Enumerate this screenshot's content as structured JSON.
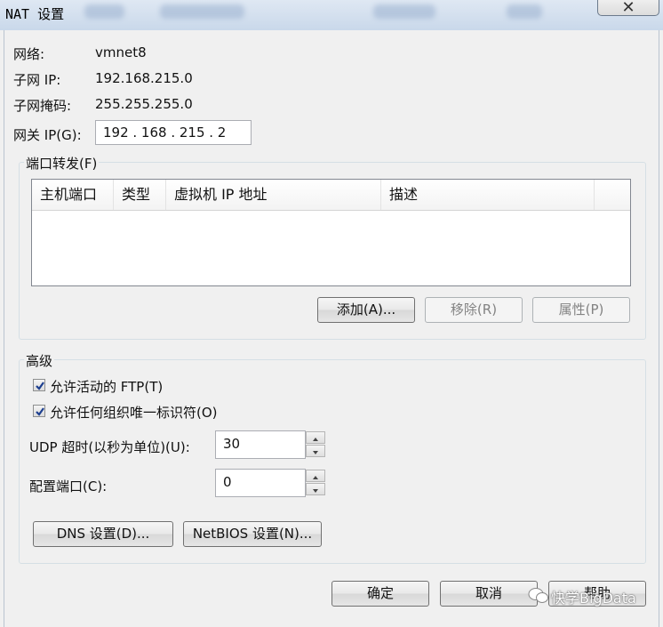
{
  "window": {
    "title": "NAT 设置",
    "close_glyph": "✕"
  },
  "network": {
    "network_label": "网络:",
    "network_value": "vmnet8",
    "subnet_ip_label": "子网 IP:",
    "subnet_ip_value": "192.168.215.0",
    "subnet_mask_label": "子网掩码:",
    "subnet_mask_value": "255.255.255.0",
    "gateway_label": "网关 IP(G):",
    "gateway_value": "192 . 168 . 215 .  2"
  },
  "port_forwarding": {
    "title": "端口转发(F)",
    "columns": [
      "主机端口",
      "类型",
      "虚拟机 IP 地址",
      "描述"
    ],
    "rows": [],
    "add_label": "添加(A)...",
    "remove_label": "移除(R)",
    "properties_label": "属性(P)"
  },
  "advanced": {
    "title": "高级",
    "allow_active_ftp_label": "允许活动的 FTP(T)",
    "allow_active_ftp_checked": true,
    "allow_any_oui_label": "允许任何组织唯一标识符(O)",
    "allow_any_oui_checked": true,
    "udp_timeout_label": "UDP 超时(以秒为单位)(U):",
    "udp_timeout_value": "30",
    "config_port_label": "配置端口(C):",
    "config_port_value": "0",
    "dns_label": "DNS 设置(D)...",
    "netbios_label": "NetBIOS 设置(N)..."
  },
  "footer": {
    "ok_label": "确定",
    "cancel_label": "取消",
    "help_label": "帮助"
  },
  "watermark": {
    "text": "快学BigData"
  },
  "colors": {
    "dialog_bg": "#f0f0f0",
    "titlebar": "#c9d8ea",
    "check_mark": "#1d3f8f"
  }
}
